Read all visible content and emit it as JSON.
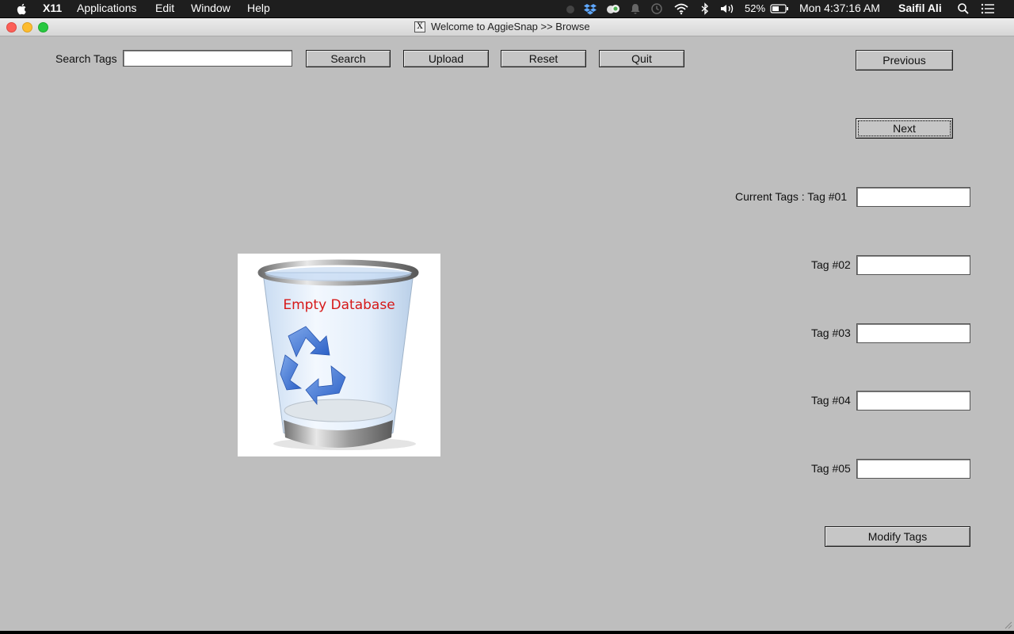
{
  "menubar": {
    "app": "X11",
    "items": [
      "Applications",
      "Edit",
      "Window",
      "Help"
    ],
    "battery": "52%",
    "clock": "Mon 4:37:16 AM",
    "user": "Saifil Ali"
  },
  "window": {
    "title": "Welcome to AggieSnap >> Browse"
  },
  "search": {
    "label": "Search Tags",
    "value": "",
    "search_button": "Search",
    "upload_button": "Upload",
    "reset_button": "Reset",
    "quit_button": "Quit"
  },
  "nav": {
    "previous": "Previous",
    "next": "Next"
  },
  "tags": {
    "current_label": "Current Tags : Tag #01",
    "tag02_label": "Tag #02",
    "tag03_label": "Tag #03",
    "tag04_label": "Tag #04",
    "tag05_label": "Tag #05",
    "values": [
      "",
      "",
      "",
      "",
      ""
    ],
    "modify_button": "Modify Tags"
  },
  "image": {
    "caption": "Empty Database",
    "icon": "recycle-bin-icon"
  },
  "colors": {
    "window_bg": "#bebebe",
    "caption_red": "#d61818",
    "recycle_blue": "#3b6fd0"
  }
}
